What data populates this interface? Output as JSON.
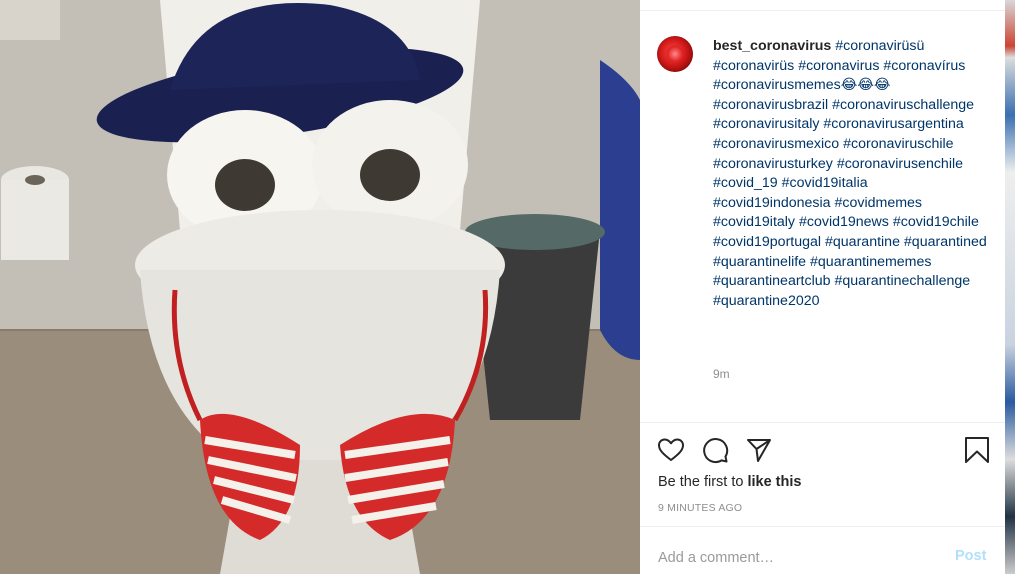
{
  "post": {
    "username": "best_coronavirus",
    "caption_tags": [
      "#coronavirüsü",
      "#coronavirüs",
      "#coronavirus",
      "#coronavírus",
      "#coronavirusmemes😂😂😂",
      "#coronavirusbrazil",
      "#coronaviruschallenge",
      "#coronavirusitaly",
      "#coronavirusargentina",
      "#coronavirusmexico",
      "#coronaviruschile",
      "#coronavirusturkey",
      "#coronavirusenchile",
      "#covid_19",
      "#covid19italia",
      "#covid19indonesia",
      "#covidmemes",
      "#covid19italy",
      "#covid19news",
      "#covid19chile",
      "#covid19portugal",
      "#quarantine",
      "#quarantined",
      "#quarantinelife",
      "#quarantinememes",
      "#quarantineartclub",
      "#quarantinechallenge",
      "#quarantine2020"
    ],
    "relative_time": "9m",
    "likes_prefix": "Be the first to ",
    "likes_action": "like this",
    "timestamp": "9 MINUTES AGO"
  },
  "actions": {
    "like_icon": "heart-icon",
    "comment_icon": "comment-icon",
    "share_icon": "paper-plane-icon",
    "save_icon": "bookmark-icon"
  },
  "comment": {
    "placeholder": "Add a comment…",
    "post_label": "Post"
  },
  "colors": {
    "hashtag": "#003569",
    "username": "#262626",
    "muted": "#8e8e8e",
    "post_disabled": "#b2dffc"
  }
}
